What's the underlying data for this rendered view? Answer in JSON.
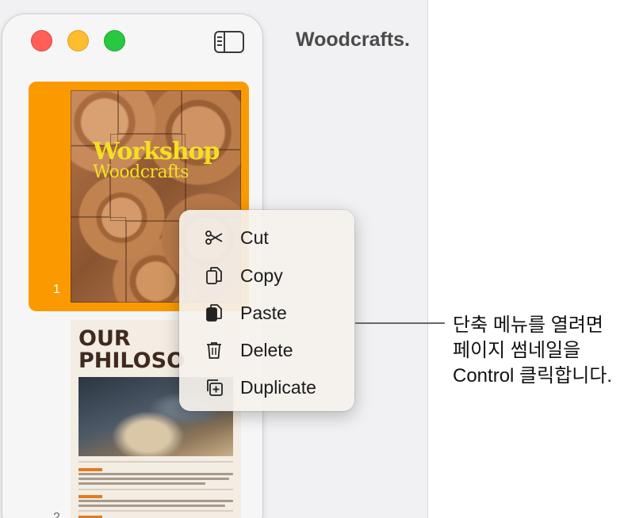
{
  "window": {
    "title": "Woodcrafts."
  },
  "pages": [
    {
      "number": "1",
      "title_line1": "Workshop",
      "title_line2": "Woodcrafts",
      "selected": true
    },
    {
      "number": "2",
      "heading": "OUR\nPHILOSO",
      "selected": false
    }
  ],
  "context_menu": {
    "items": [
      {
        "label": "Cut",
        "icon": "scissors-icon"
      },
      {
        "label": "Copy",
        "icon": "copy-icon"
      },
      {
        "label": "Paste",
        "icon": "paste-icon"
      },
      {
        "label": "Delete",
        "icon": "trash-icon"
      },
      {
        "label": "Duplicate",
        "icon": "duplicate-icon"
      }
    ]
  },
  "callout": {
    "text": "단축 메뉴를 열려면\n페이지 썸네일을\nControl 클릭합니다."
  },
  "colors": {
    "selection": "#fa9a00",
    "close": "#ff5f57",
    "minimize": "#febc2e",
    "maximize": "#28c840",
    "thumb_title": "#f3e021"
  }
}
